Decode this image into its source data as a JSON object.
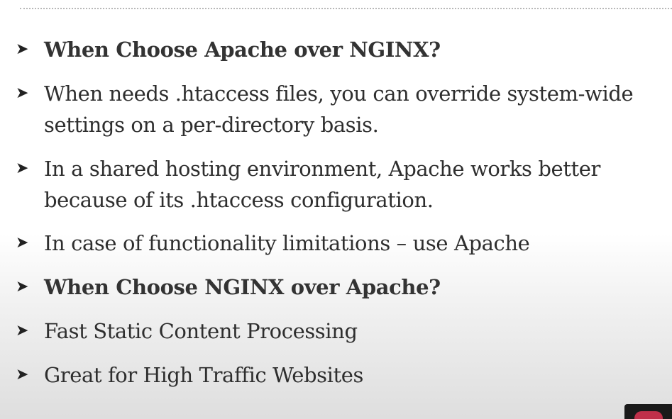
{
  "slide": {
    "bullets": [
      {
        "text": "When Choose Apache over NGINX?",
        "bold": true
      },
      {
        "text": "When needs .htaccess files, you can override system-wide\nsettings on a per-directory basis.",
        "bold": false
      },
      {
        "text": "In a shared hosting environment, Apache works better\nbecause of its .htaccess configuration.",
        "bold": false
      },
      {
        "text": "In case of functionality limitations – use Apache",
        "bold": false
      },
      {
        "text": "When Choose NGINX over Apache?",
        "bold": true
      },
      {
        "text": "Fast Static Content Processing",
        "bold": false
      },
      {
        "text": "Great for High Traffic Websites",
        "bold": false
      }
    ],
    "bullet_glyph": "➤",
    "bullet_icon": "arrow-icon"
  },
  "colors": {
    "text": "#2e2e2e",
    "corner_accent": "#c0304a"
  }
}
